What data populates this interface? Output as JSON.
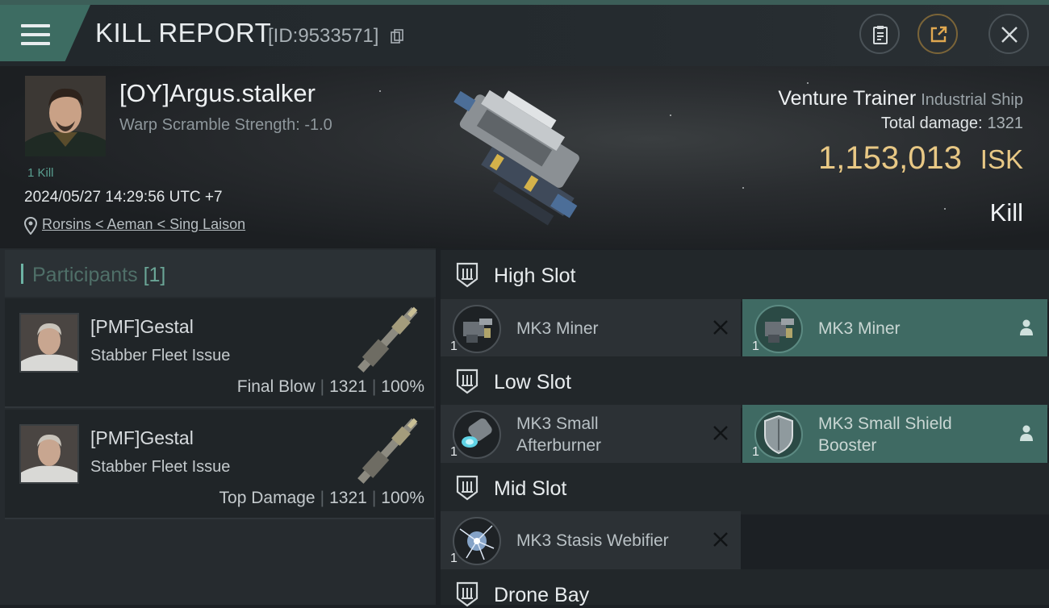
{
  "header": {
    "title": "KILL REPORT",
    "report_id": "[ID:9533571]"
  },
  "victim": {
    "name": "[OY]Argus.stalker",
    "warp_scramble": "Warp Scramble Strength: -1.0",
    "kill_count": "1 Kill",
    "datetime": "2024/05/27 14:29:56 UTC +7",
    "location": "Rorsins < Aeman < Sing Laison"
  },
  "ship": {
    "name": "Venture Trainer",
    "class": "Industrial Ship",
    "total_damage_label": "Total damage:",
    "total_damage_value": "1321",
    "isk_value": "1,153,013",
    "isk_unit": "ISK",
    "result": "Kill"
  },
  "participants": {
    "label": "Participants",
    "count": "[1]",
    "rows": [
      {
        "name": "[PMF]Gestal",
        "ship": "Stabber Fleet Issue",
        "tag": "Final Blow",
        "damage": "1321",
        "percent": "100%"
      },
      {
        "name": "[PMF]Gestal",
        "ship": "Stabber Fleet Issue",
        "tag": "Top Damage",
        "damage": "1321",
        "percent": "100%"
      }
    ]
  },
  "slots": {
    "high": {
      "label": "High Slot",
      "items": [
        {
          "name": "MK3 Miner",
          "qty": "1",
          "status": "destroyed"
        },
        {
          "name": "MK3 Miner",
          "qty": "1",
          "status": "dropped"
        }
      ]
    },
    "low": {
      "label": "Low Slot",
      "items": [
        {
          "name_line1": "MK3 Small",
          "name_line2": "Afterburner",
          "qty": "1",
          "status": "destroyed"
        },
        {
          "name_line1": "MK3 Small Shield",
          "name_line2": "Booster",
          "qty": "1",
          "status": "dropped"
        }
      ]
    },
    "mid": {
      "label": "Mid Slot",
      "items": [
        {
          "name": "MK3 Stasis Webifier",
          "qty": "1",
          "status": "destroyed"
        }
      ]
    },
    "drone": {
      "label": "Drone Bay"
    }
  },
  "colors": {
    "accent_teal": "#3f6a63",
    "isk_gold": "#e8c885",
    "header_tab": "#3d6c62"
  },
  "icons": {
    "menu": "hamburger-menu-icon",
    "copy": "copy-icon",
    "clipboard": "clipboard-icon",
    "share": "share-export-icon",
    "close": "close-icon",
    "location": "map-pin-icon",
    "slot": "slot-shield-icon",
    "destroyed": "x-mark-icon",
    "dropped": "person-icon"
  }
}
